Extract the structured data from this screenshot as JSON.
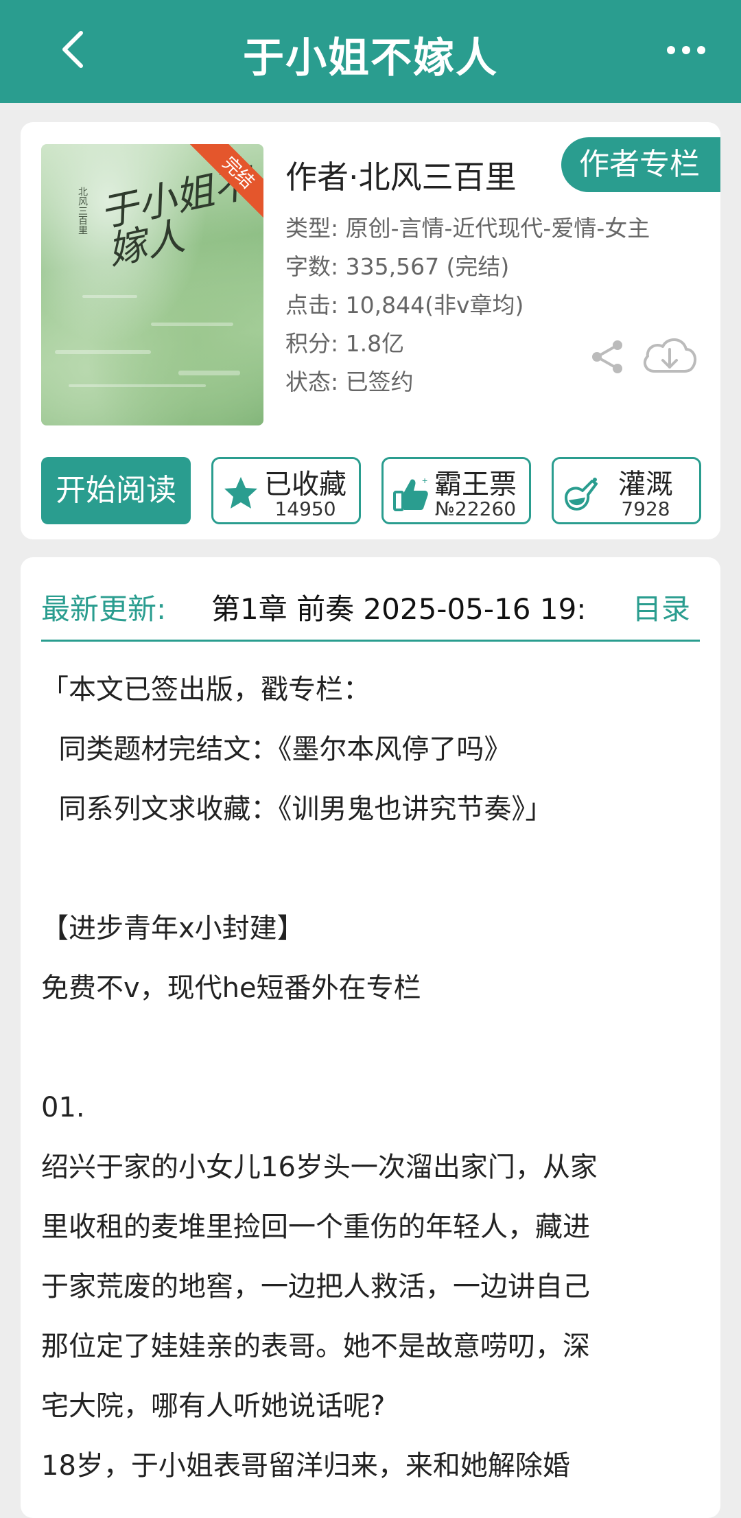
{
  "header": {
    "title": "于小姐不嫁人"
  },
  "book": {
    "cover": {
      "badge": "完结",
      "title_art": "于小姐不嫁人",
      "author_small": "北风三百里"
    },
    "author": "作者·北风三百里",
    "author_column_label": "作者专栏",
    "meta": {
      "type": "类型: 原创-言情-近代现代-爱情-女主",
      "words": "字数: 335,567 (完结)",
      "clicks": "点击: 10,844(非v章均)",
      "score": "积分: 1.8亿",
      "status": "状态: 已签约"
    },
    "read_label": "开始阅读",
    "stats": [
      {
        "label": "已收藏",
        "count": "14950",
        "icon": "star-icon"
      },
      {
        "label": "霸王票",
        "count": "№22260",
        "icon": "thumbs-up-icon"
      },
      {
        "label": "灌溉",
        "count": "7928",
        "icon": "watering-icon"
      }
    ]
  },
  "latest": {
    "label": "最新更新:",
    "chapter": "第1章  前奏  2025-05-16 19:",
    "toc_label": "目录"
  },
  "intro": [
    "「本文已签出版，戳专栏：",
    "  同类题材完结文：《墨尔本风停了吗》",
    "  同系列文求收藏：《训男鬼也讲究节奏》」",
    "",
    "【进步青年x小封建】",
    "免费不v，现代he短番外在专栏",
    "",
    "01.",
    "绍兴于家的小女儿16岁头一次溜出家门，从家",
    "里收租的麦堆里捡回一个重伤的年轻人，藏进",
    "于家荒废的地窖，一边把人救活，一边讲自己",
    "那位定了娃娃亲的表哥。她不是故意唠叨，深",
    "宅大院，哪有人听她说话呢?",
    "18岁，于小姐表哥留洋归来，来和她解除婚"
  ],
  "colors": {
    "accent": "#2a9d8f",
    "ribbon": "#e4562c",
    "background": "#ededed"
  }
}
